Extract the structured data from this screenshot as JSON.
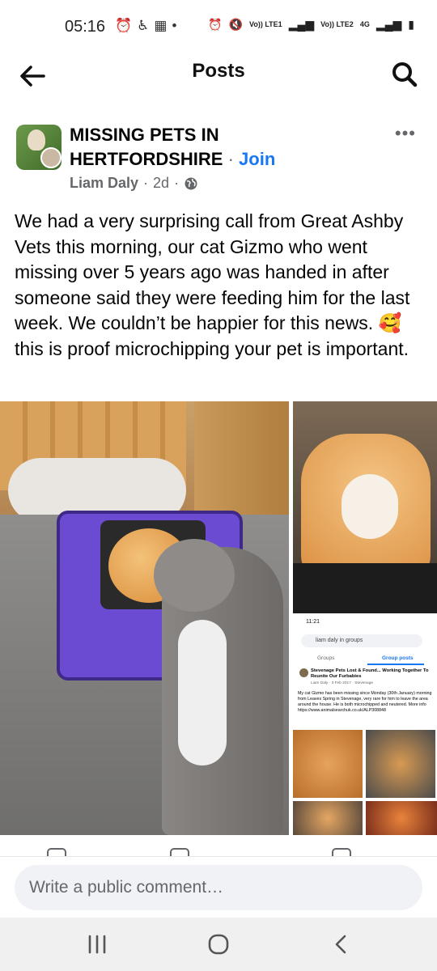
{
  "status_bar": {
    "time": "05:16",
    "left_icons": [
      "alarm-icon",
      "accessibility-icon",
      "calendar-icon",
      "dot-icon"
    ],
    "right_labels": [
      "Vo)) LTE1",
      "Vo)) LTE2",
      "4G"
    ],
    "right_icons": [
      "alarm-icon",
      "mute-icon",
      "signal-icon",
      "signal-icon",
      "battery-icon"
    ]
  },
  "header": {
    "title": "Posts",
    "back_icon": "arrow-left-icon",
    "search_icon": "search-icon"
  },
  "post": {
    "group_name": "MISSING PETS IN HERTFORDSHIRE",
    "separator": "·",
    "join_label": "Join",
    "author": "Liam Daly",
    "time": "2d",
    "privacy_icon": "globe-icon",
    "more_label": "•••",
    "body": "We had a very surprising call from Great Ashby Vets this morning, our cat Gizmo who went missing over 5 years ago was handed in after someone said they were feeding him for the last week. We couldn’t be happier for this news. 🥰 this is proof microchipping your pet is important."
  },
  "embedded_screenshot": {
    "time": "11:21",
    "search_text": "liam daly in groups",
    "tab_groups": "Groups",
    "tab_group_posts": "Group posts",
    "post_title": "Stevenage Pets Lost & Found... Working Together To Reunite Our Furbabies",
    "post_meta": "Liam Daly · 3 Feb 2017 · Stevenage",
    "post_text": "My cat Gizmo has been missing since Monday (30th January) morning from Leaves Spring in Stevenage, very rare for him to leave the area around the house. He is both microchipped and neutered. More info https://www.animalsearchuk.co.uk/ALP308848"
  },
  "comment": {
    "placeholder": "Write a public comment…"
  },
  "nav": {
    "recent_icon": "recent-apps-icon",
    "home_icon": "home-icon",
    "back_icon": "back-chevron-icon"
  },
  "colors": {
    "link_blue": "#1877f2",
    "meta_grey": "#65676b",
    "text": "#050505"
  }
}
